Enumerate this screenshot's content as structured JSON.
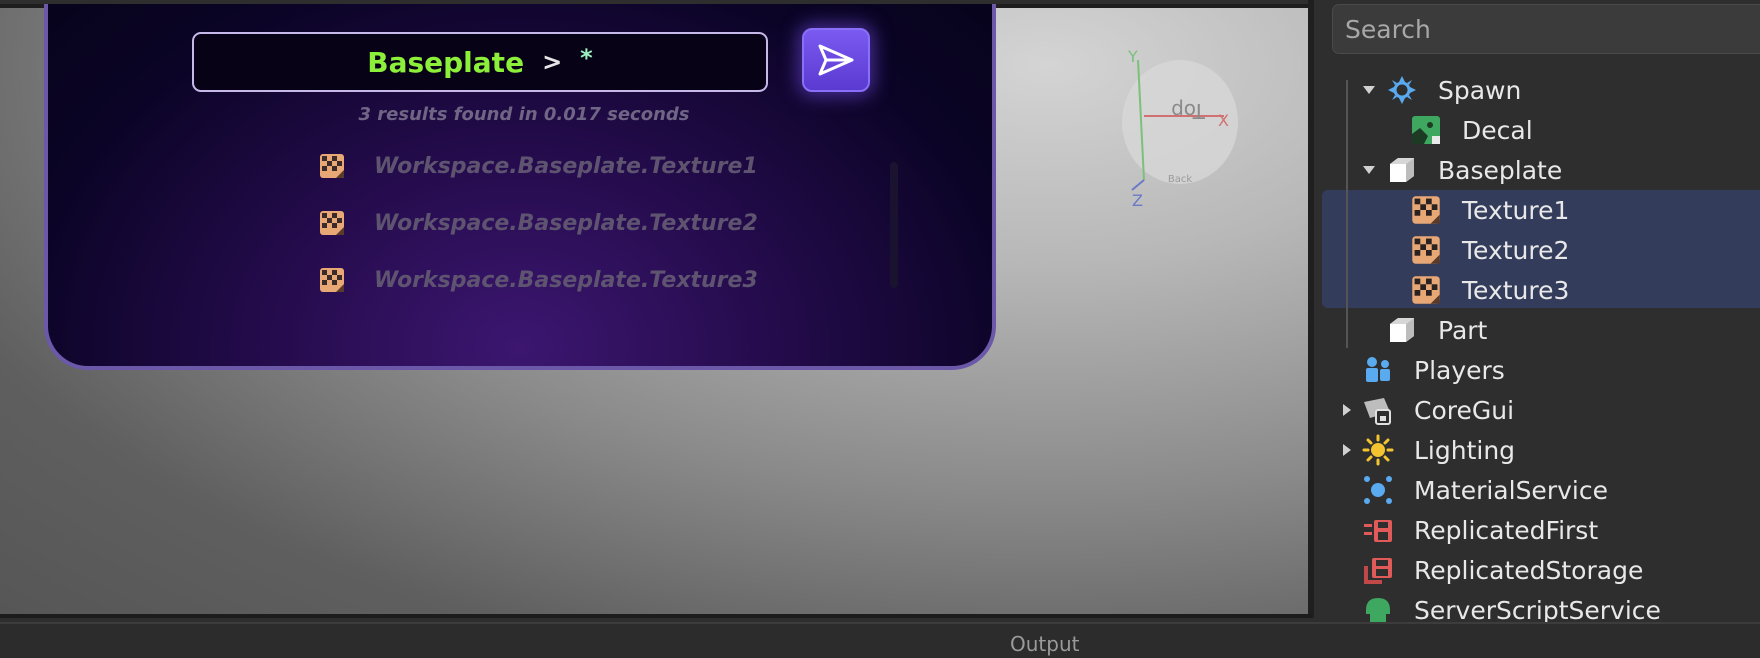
{
  "command_bar": {
    "query_path": "Baseplate",
    "query_separator": ">",
    "query_wildcard": "*",
    "send_icon": "paper-plane-icon",
    "results_summary": "3 results found in 0.017 seconds",
    "results": [
      {
        "icon": "texture-icon",
        "label": "Workspace.Baseplate.Texture1"
      },
      {
        "icon": "texture-icon",
        "label": "Workspace.Baseplate.Texture2"
      },
      {
        "icon": "texture-icon",
        "label": "Workspace.Baseplate.Texture3"
      }
    ]
  },
  "gizmo": {
    "axis_x": "X",
    "axis_y": "Y",
    "axis_z": "Z",
    "face_top": "Top",
    "face_back": "Back"
  },
  "explorer": {
    "search_placeholder": "Search",
    "items": [
      {
        "label": "Spawn",
        "icon": "spawn-icon",
        "expanded": true
      },
      {
        "label": "Decal",
        "icon": "decal-icon"
      },
      {
        "label": "Baseplate",
        "icon": "part-icon",
        "expanded": true
      },
      {
        "label": "Texture1",
        "icon": "texture-icon",
        "selected": true
      },
      {
        "label": "Texture2",
        "icon": "texture-icon",
        "selected": true
      },
      {
        "label": "Texture3",
        "icon": "texture-icon",
        "selected": true
      },
      {
        "label": "Part",
        "icon": "part-icon"
      },
      {
        "label": "Players",
        "icon": "players-icon"
      },
      {
        "label": "CoreGui",
        "icon": "coregui-icon",
        "expanded": false
      },
      {
        "label": "Lighting",
        "icon": "lighting-icon",
        "expanded": false
      },
      {
        "label": "MaterialService",
        "icon": "material-service-icon"
      },
      {
        "label": "ReplicatedFirst",
        "icon": "replicated-first-icon"
      },
      {
        "label": "ReplicatedStorage",
        "icon": "replicated-storage-icon"
      },
      {
        "label": "ServerScriptService",
        "icon": "server-script-service-icon"
      }
    ]
  },
  "output": {
    "label": "Output"
  },
  "colors": {
    "query_path": "#8cf03a",
    "send_button": "#6a4ae0",
    "selection": "#343c5c",
    "panel_border": "#6b58a8"
  }
}
